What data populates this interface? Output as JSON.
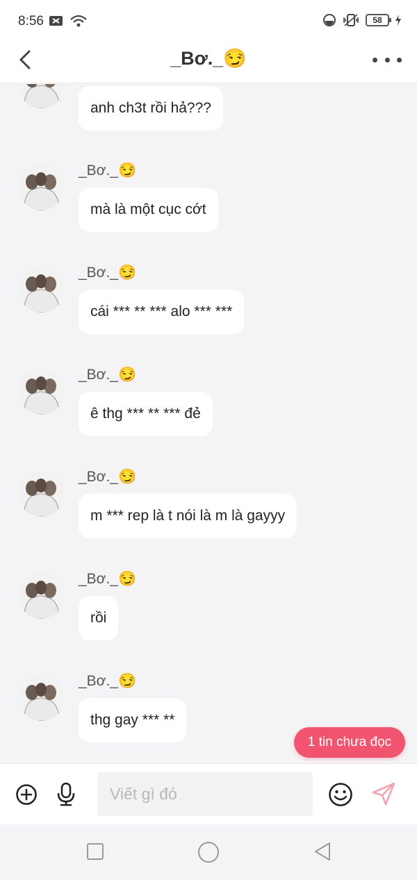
{
  "status_bar": {
    "time": "8:56",
    "battery": "58"
  },
  "header": {
    "title": "_Bơ._😏"
  },
  "messages": [
    {
      "sender": "",
      "text": "anh ch3t rồi hả???"
    },
    {
      "sender": "_Bơ._😏",
      "text": "mà là một cục cớt"
    },
    {
      "sender": "_Bơ._😏",
      "text": "cái *** ** *** alo *** ***"
    },
    {
      "sender": "_Bơ._😏",
      "text": " ê thg *** ** *** đẻ"
    },
    {
      "sender": "_Bơ._😏",
      "text": "m *** rep là t nói là m là gayyy"
    },
    {
      "sender": "_Bơ._😏",
      "text": "rồi"
    },
    {
      "sender": "_Bơ._😏",
      "text": "thg gay *** **"
    }
  ],
  "unread": {
    "label": "1 tin chưa đọc"
  },
  "composer": {
    "placeholder": "Viết gì đó",
    "value": ""
  },
  "colors": {
    "accent": "#f0546e",
    "bubble": "#ffffff",
    "background": "#f4f4f6"
  },
  "icons": {
    "add": "plus-circle-icon",
    "voice": "microphone-icon",
    "emoji": "smiley-icon",
    "send": "send-icon",
    "back": "chevron-left-icon",
    "more": "more-dots-icon"
  }
}
